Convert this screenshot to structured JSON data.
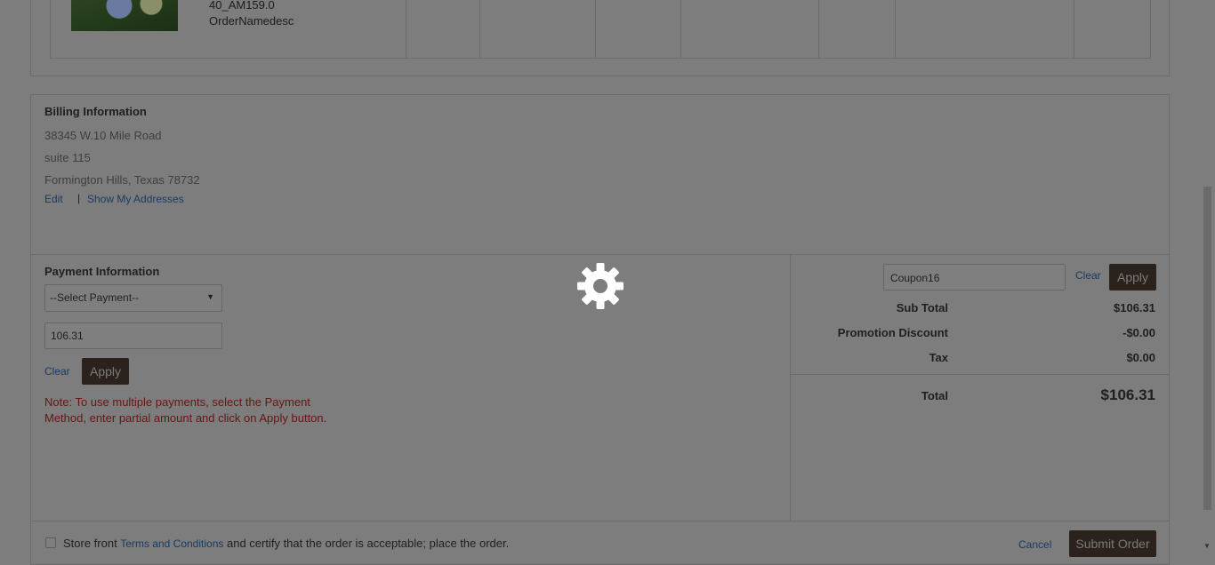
{
  "product": {
    "sku": "40_AM159.0",
    "description": "OrderNamedesc"
  },
  "billing": {
    "title": "Billing Information",
    "address_line1": "38345 W.10 Mile Road",
    "address_line2": "suite 115",
    "address_line3": "Formington Hills, Texas 78732",
    "edit_label": "Edit",
    "separator": "|",
    "show_addresses_label": "Show My Addresses"
  },
  "payment": {
    "title": "Payment Information",
    "select_value": "--Select Payment--",
    "amount_value": "106.31",
    "clear_label": "Clear",
    "apply_label": "Apply",
    "note": "Note: To use multiple payments, select the Payment Method, enter partial amount and click on Apply button."
  },
  "summary": {
    "coupon_value": "Coupon16",
    "clear_label": "Clear",
    "apply_label": "Apply",
    "rows": [
      {
        "label": "Sub Total",
        "value": "$106.31"
      },
      {
        "label": "Promotion Discount",
        "value": "-$0.00"
      },
      {
        "label": "Tax",
        "value": "$0.00"
      }
    ],
    "total_label": "Total",
    "total_value": "$106.31"
  },
  "footer": {
    "terms_prefix": "Store front ",
    "terms_link": "Terms and Conditions",
    "terms_suffix": " and certify that the order is acceptable; place the order.",
    "cancel_label": "Cancel",
    "submit_label": "Submit Order"
  },
  "colors": {
    "overlay": "#7d7d7d",
    "button_dark": "#2c221d",
    "link": "#1a3a62",
    "note": "#6a1414",
    "spinner": "#ffffff"
  },
  "icons": {
    "loading": "gear-icon",
    "select_caret": "caret-down-icon",
    "scroll_down": "arrow-down-icon"
  }
}
